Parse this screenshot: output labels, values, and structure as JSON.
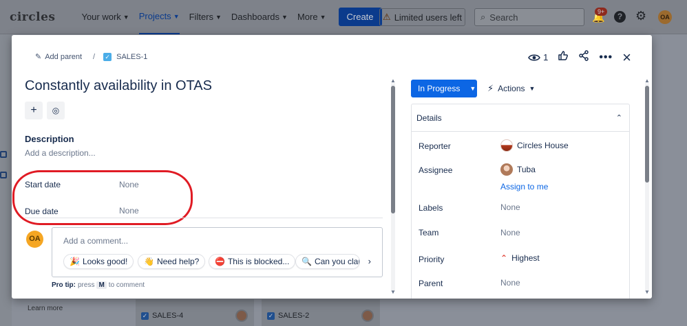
{
  "topnav": {
    "logo": "circles",
    "items": [
      {
        "label": "Your work"
      },
      {
        "label": "Projects"
      },
      {
        "label": "Filters"
      },
      {
        "label": "Dashboards"
      },
      {
        "label": "More"
      }
    ],
    "create_label": "Create",
    "limited_label": "Limited users left",
    "search_placeholder": "Search",
    "notifications_badge": "9+",
    "avatar_initials": "OA"
  },
  "background": {
    "learn_more": "Learn more",
    "cards": [
      {
        "key": "SALES-4"
      },
      {
        "key": "SALES-2"
      }
    ]
  },
  "modal": {
    "breadcrumb": {
      "add_parent": "Add parent",
      "separator": "/",
      "issue_key": "SALES-1"
    },
    "watchers_count": "1",
    "title": "Constantly availability in OTAS",
    "description": {
      "heading": "Description",
      "placeholder": "Add a description..."
    },
    "fields": {
      "start_date": {
        "label": "Start date",
        "value": "None"
      },
      "due_date": {
        "label": "Due date",
        "value": "None"
      }
    },
    "comment": {
      "avatar_initials": "OA",
      "placeholder": "Add a comment...",
      "chips": [
        {
          "emoji": "🎉",
          "label": "Looks good!"
        },
        {
          "emoji": "👋",
          "label": "Need help?"
        },
        {
          "emoji": "⛔",
          "label": "This is blocked..."
        },
        {
          "emoji": "🔍",
          "label": "Can you clarify...?"
        }
      ],
      "protip_label": "Pro tip:",
      "protip_press": "press",
      "protip_key": "M",
      "protip_rest": "to comment"
    },
    "status": "In Progress",
    "actions_label": "Actions",
    "details": {
      "heading": "Details",
      "reporter": {
        "label": "Reporter",
        "value": "Circles House"
      },
      "assignee": {
        "label": "Assignee",
        "value": "Tuba",
        "assign_link": "Assign to me"
      },
      "labels": {
        "label": "Labels",
        "value": "None"
      },
      "team": {
        "label": "Team",
        "value": "None"
      },
      "priority": {
        "label": "Priority",
        "value": "Highest"
      },
      "parent": {
        "label": "Parent",
        "value": "None"
      }
    }
  },
  "colors": {
    "primary": "#0c66e4",
    "annotation_red": "#e01b24",
    "avatar_orange": "#f5a623"
  }
}
